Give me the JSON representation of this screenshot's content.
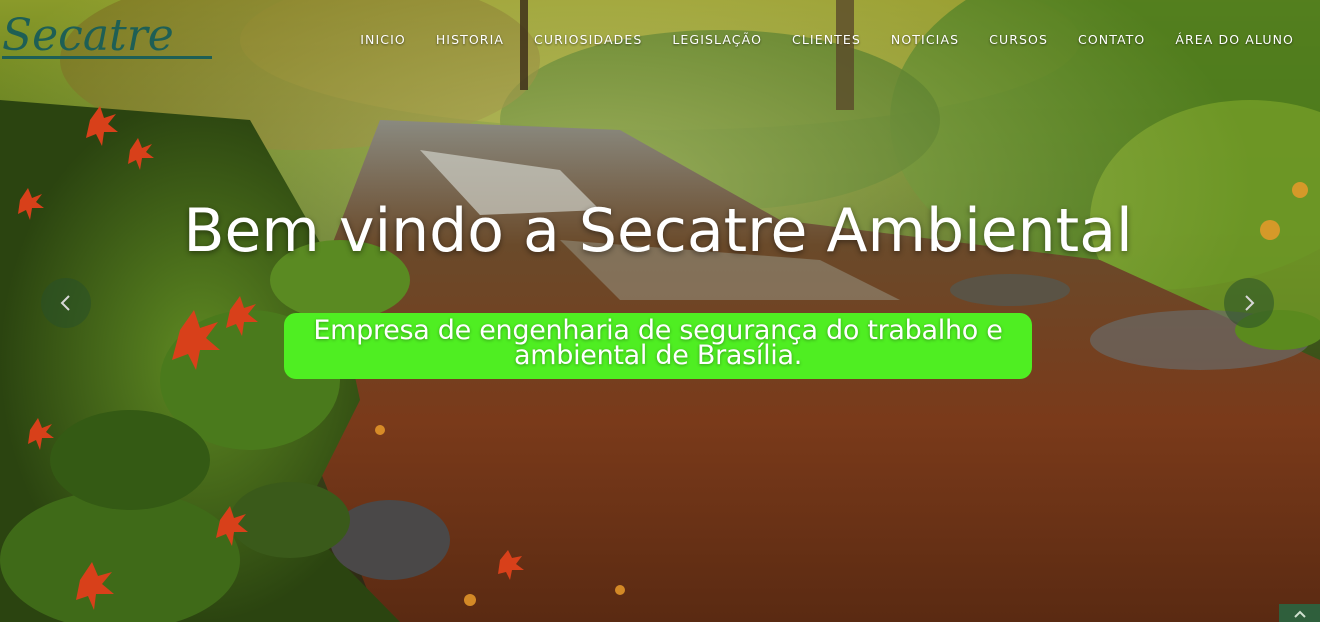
{
  "brand": {
    "logo_text": "Secatre",
    "logo_color": "#1e5f55"
  },
  "nav": {
    "items": [
      {
        "label": "INICIO"
      },
      {
        "label": "HISTORIA"
      },
      {
        "label": "CURIOSIDADES"
      },
      {
        "label": "LEGISLAÇÃO"
      },
      {
        "label": "CLIENTES"
      },
      {
        "label": "NOTICIAS"
      },
      {
        "label": "CURSOS"
      },
      {
        "label": "CONTATO"
      },
      {
        "label": "ÁREA DO ALUNO"
      }
    ]
  },
  "hero": {
    "headline": "Bem vindo a Secatre Ambiental",
    "subtitle_line1": "Empresa de engenharia de segurança do trabalho e",
    "subtitle_line2": "ambiental de Brasília.",
    "subtitle_bg": "#4fee22"
  },
  "carousel": {
    "prev_icon": "chevron-left-icon",
    "next_icon": "chevron-right-icon"
  },
  "back_to_top": {
    "icon": "chevron-up-icon",
    "color": "#2f5f3c"
  }
}
